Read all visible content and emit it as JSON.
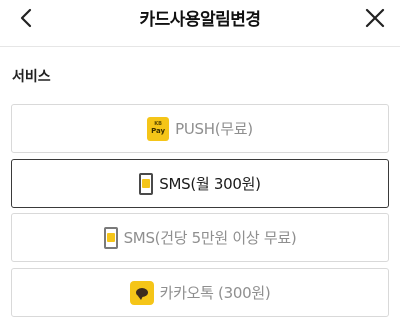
{
  "header": {
    "title": "카드사용알림변경",
    "back_icon": "chevron-left-icon",
    "close_icon": "close-icon"
  },
  "section": {
    "label": "서비스"
  },
  "options": [
    {
      "label": "PUSH(무료)",
      "icon": "kb-pay-icon",
      "icon_text_top": "KB",
      "icon_text_bottom": "Pay",
      "selected": false
    },
    {
      "label": "SMS(월 300원)",
      "icon": "sms-phone-icon",
      "selected": true
    },
    {
      "label": "SMS(건당 5만원 이상 무료)",
      "icon": "sms-phone-icon",
      "selected": false
    },
    {
      "label": "카카오톡 (300원)",
      "icon": "kakaotalk-icon",
      "selected": false
    }
  ],
  "colors": {
    "accent": "#f5c518",
    "selected_border": "#3a3a3a",
    "unselected_border": "#d9d9d9",
    "muted_text": "#8f8f8f"
  }
}
